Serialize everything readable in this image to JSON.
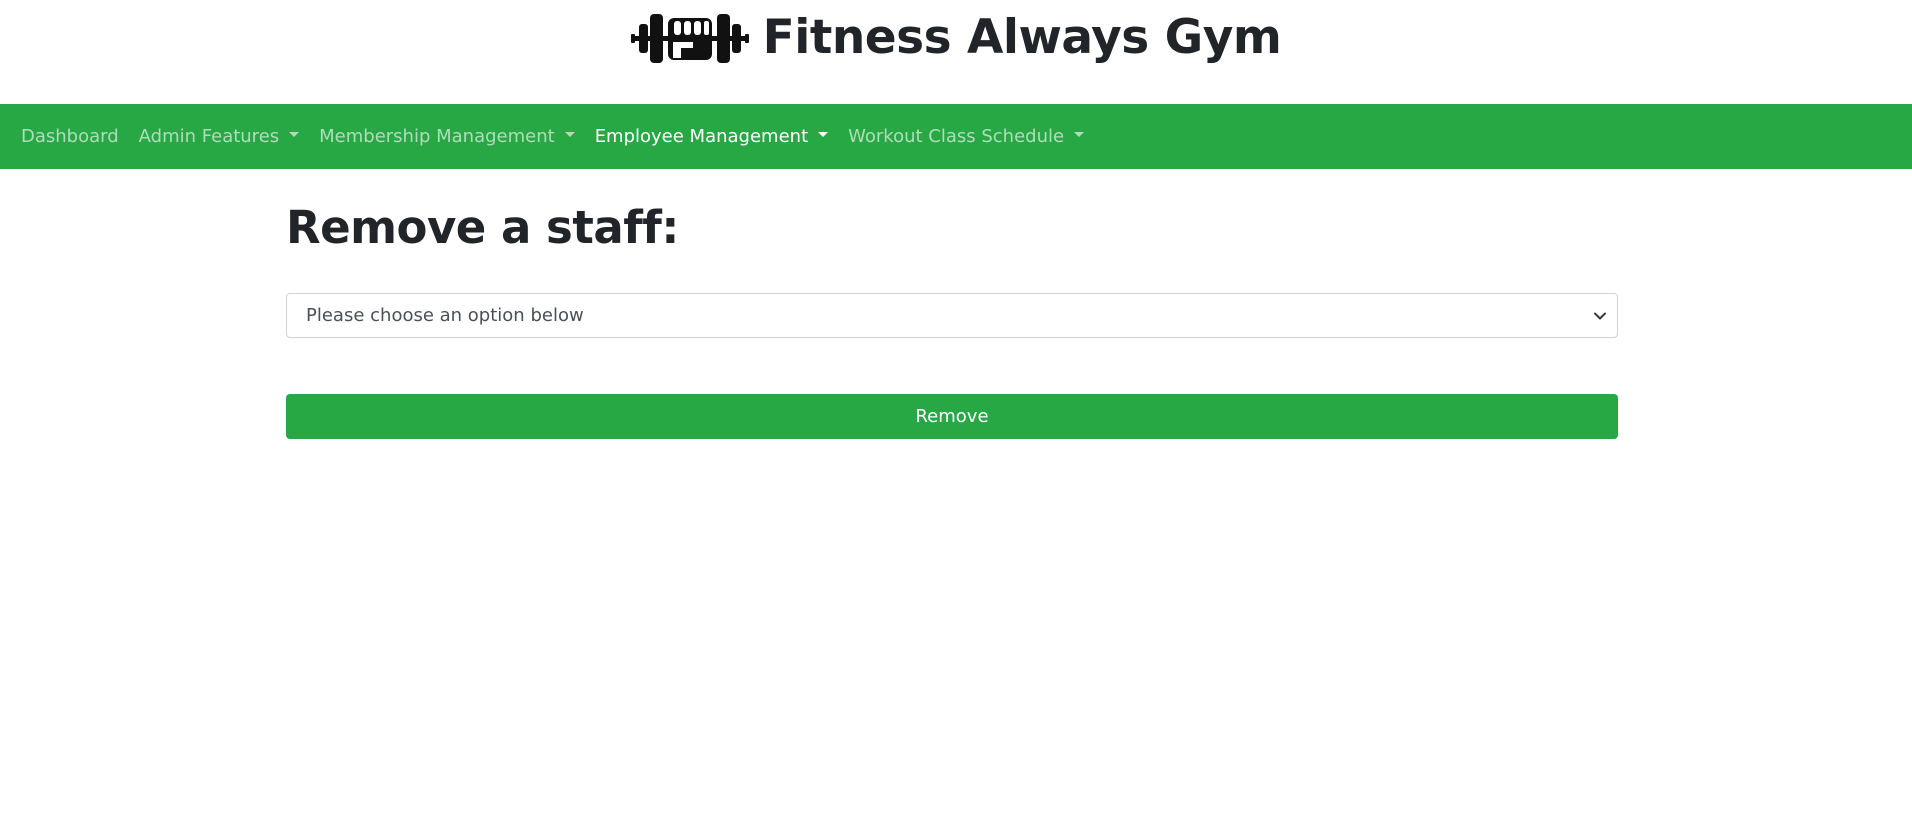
{
  "header": {
    "logo_icon": "dumbbell-fist-icon",
    "title": "Fitness Always Gym"
  },
  "nav": {
    "items": [
      {
        "label": "Dashboard",
        "dropdown": false,
        "active": false
      },
      {
        "label": "Admin Features",
        "dropdown": true,
        "active": false
      },
      {
        "label": "Membership Management",
        "dropdown": true,
        "active": false
      },
      {
        "label": "Employee Management",
        "dropdown": true,
        "active": true
      },
      {
        "label": "Workout Class Schedule",
        "dropdown": true,
        "active": false
      }
    ]
  },
  "main": {
    "title": "Remove a staff:",
    "select": {
      "selected": "Please choose an option below"
    },
    "remove_label": "Remove"
  },
  "colors": {
    "brand_green": "#28a745",
    "text_dark": "#212529"
  }
}
